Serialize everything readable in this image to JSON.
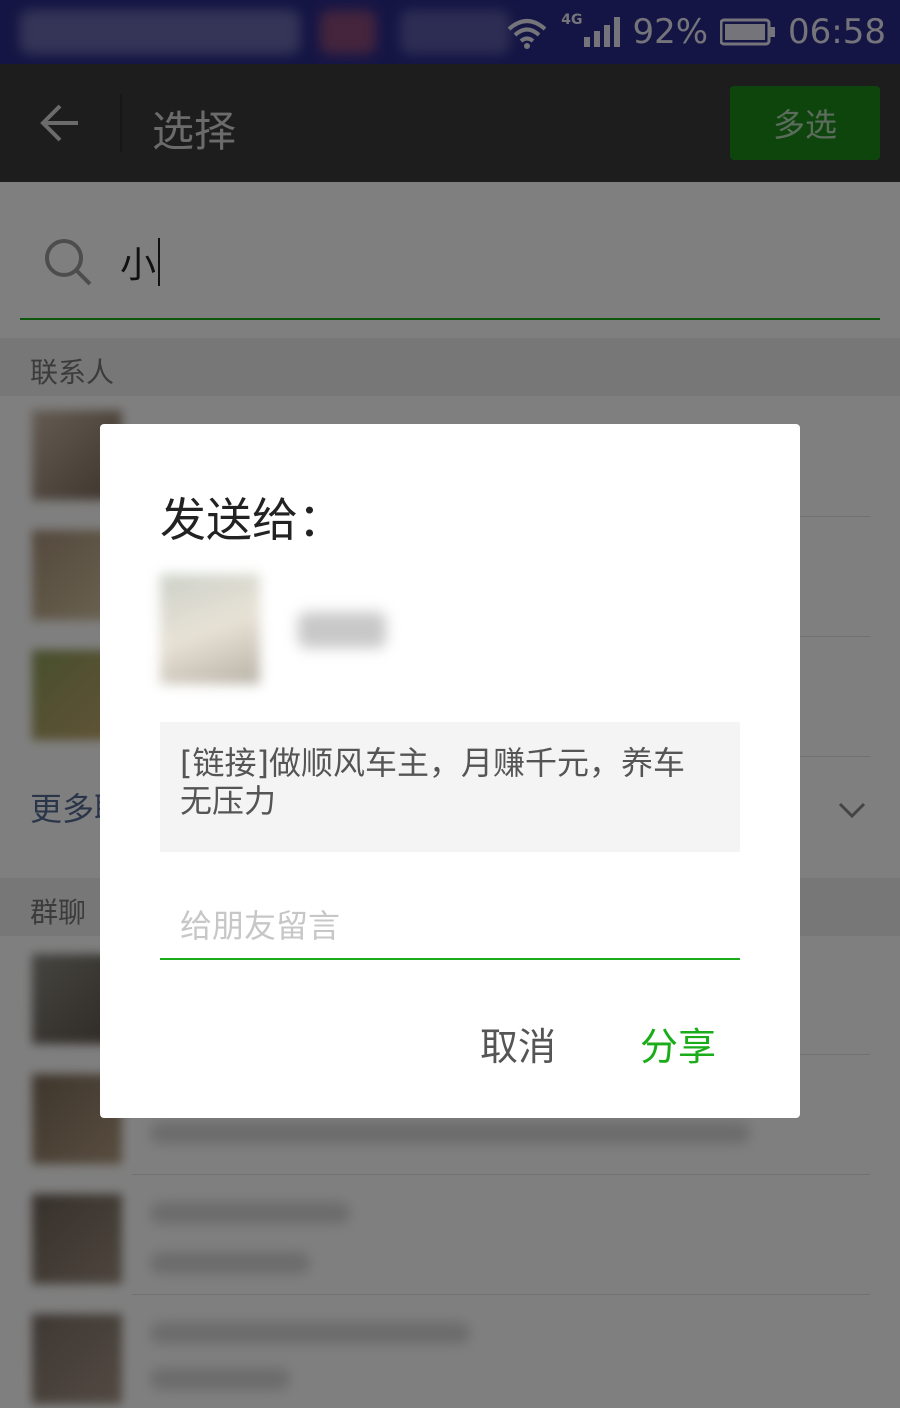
{
  "status_bar": {
    "network": "4G",
    "battery": "92%",
    "time": "06:58"
  },
  "toolbar": {
    "title": "选择",
    "multi_select": "多选"
  },
  "search": {
    "query": "小"
  },
  "sections": {
    "contacts": "联系人",
    "more": "更多联系人",
    "groups": "群聊"
  },
  "dialog": {
    "title": "发送给：",
    "link_text": "[链接]做顺风车主，月赚千元，养车无压力",
    "message_placeholder": "给朋友留言",
    "cancel": "取消",
    "share": "分享"
  },
  "colors": {
    "accent": "#1aad19",
    "toolbar": "#3a3a3a",
    "status_bar": "#2b2b8a"
  }
}
